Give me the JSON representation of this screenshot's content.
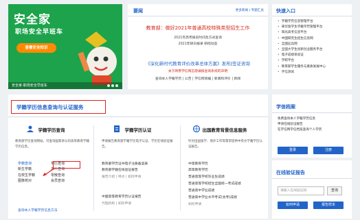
{
  "banner": {
    "title": "安全家",
    "subtitle": "职场安全早班车",
    "cta": "查看安全知识",
    "caption": "安全家-职场安全早班车"
  },
  "news": {
    "header": "要闻",
    "links": [
      "更多新闻",
      "专题汇总"
    ],
    "headline1": "教育部：做好2021年普通高校特殊类型招生工作",
    "sub1": [
      "2021年高考报名时间及方式查询",
      "2021年研日报录 研招动态"
    ],
    "headline2_a": "《深化新时代教育评价改革总体方案》发布",
    "headline2_sep": "|",
    "headline2_b": "签证咨询",
    "red1": "关于网券学信网志愿填报查询系统的声明",
    "sub2": "查询本人学籍学历 | 公告 | 学信网简编 | 新闻和评价 | 新闻"
  },
  "quick": {
    "header": "快速入口",
    "items": [
      "学籍学历信息管理平台",
      "来华留学生学籍学历管理平台",
      "阳光高考信息平台",
      "中国研究生招生信息网",
      "全国征兵网",
      "全国大学生创新创业服务平台",
      "电子成绩单验证",
      "学职平台",
      "教育部学生服务与素质发展中心",
      "学信测试"
    ]
  },
  "main": {
    "title": "学籍学历信息查询与认证服务",
    "col1": {
      "title": "学籍学历查询",
      "desc": "教育部学历查询网站，可查询国家承认的高等教育学籍学历信息。",
      "links": [
        "学籍查询",
        "学历查询",
        "新生学籍",
        "本人查询",
        "在校生学籍",
        "零散查询",
        "图像校对",
        "会员查询"
      ],
      "foot": "查询本人学籍学历信息方法"
    },
    "col2": {
      "title": "学籍学历认证",
      "desc": "申请报告教育部学籍学历电子认证、学历在线验证报告。",
      "links": [
        "教育部学历证书电子注册备案表",
        "教育部学籍在线验证报告",
        "报告介绍 | 特点 | 如何申请",
        "中国高等教育学历认证报告",
        "代理机构 | 如何申请"
      ]
    },
    "col3": {
      "title": "出国教育背景信息服务",
      "desc": "针对出国留学、境外工作等需求提供中英文学籍学历认证报告。",
      "links": [
        "中等教育学历",
        "高等教育学历",
        "普通高等学校毕业生成绩",
        "普通高等学校招生全国统一考试成绩",
        "普通高中学业成绩",
        "普通高中学业水平考试(会考)成绩",
        "如何申请"
      ]
    }
  },
  "archive": {
    "header": "学信档案",
    "lines": [
      "免费查询本人学籍学历信息",
      "申请在线验证报告",
      "在学信网学信档案查询个人学历"
    ],
    "login": "登录",
    "register": "注册"
  },
  "verify": {
    "header": "在线验证报告",
    "placeholder": "请输入在线验证码",
    "query": "查询",
    "apply": "如何申请",
    "sample": "报告样本"
  },
  "colors": {
    "accent": "#2264c8",
    "red": "#d52a1c",
    "green": "#1da34c",
    "orange": "#ff8a00"
  }
}
